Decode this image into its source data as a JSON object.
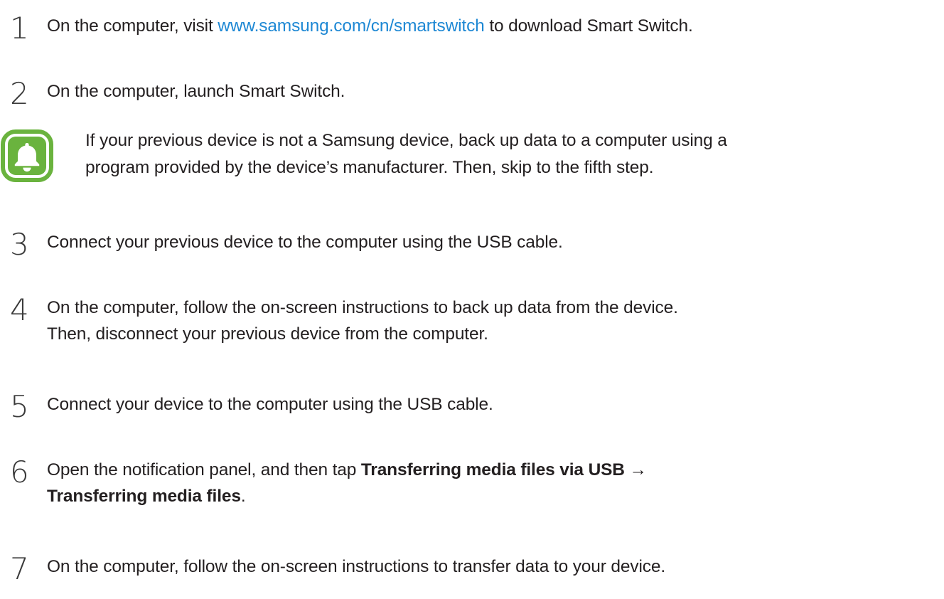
{
  "steps": [
    {
      "number": "1",
      "text_before": "On the computer, visit ",
      "link": "www.samsung.com/cn/smartswitch",
      "text_after": " to download Smart Switch."
    },
    {
      "number": "2",
      "text": "On the computer, launch Smart Switch."
    },
    {
      "number": "3",
      "text": "Connect your previous device to the computer using the USB cable."
    },
    {
      "number": "4",
      "line1": "On the computer, follow the on-screen instructions to back up data from the device.",
      "line2": "Then, disconnect your previous device from the computer."
    },
    {
      "number": "5",
      "text": "Connect your device to the computer using the USB cable."
    },
    {
      "number": "6",
      "text_before": "Open the notification panel, and then tap ",
      "bold1": "Transferring media files via USB",
      "arrow": " →",
      "bold2": "Transferring media files",
      "period": "."
    },
    {
      "number": "7",
      "text": "On the computer, follow the on-screen instructions to transfer data to your device."
    }
  ],
  "note": {
    "icon": "bell-icon",
    "line1": "If your previous device is not a Samsung device, back up data to a computer using a",
    "line2": "program provided by the device’s manufacturer. Then, skip to the fifth step."
  },
  "colors": {
    "text": "#231f20",
    "link": "#1e88d4",
    "icon_green": "#6ab33e",
    "number": "#3a3a3a"
  }
}
